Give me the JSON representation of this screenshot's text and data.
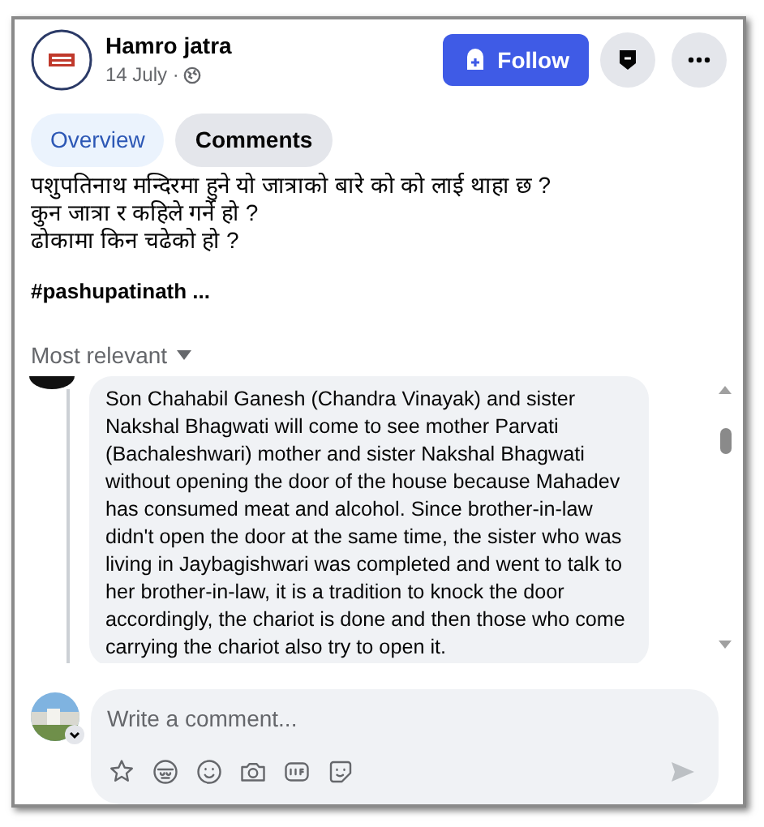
{
  "post": {
    "author": "Hamro jatra",
    "date": "14 July ·",
    "follow_button": "Follow"
  },
  "tabs": [
    {
      "label": "Overview",
      "selected": true
    },
    {
      "label": "Comments",
      "selected": false
    }
  ],
  "post_text": [
    "पशुपतिनाथ मन्दिरमा हुने यो जात्राको बारे को को लाई थाहा छ ?",
    "कुन जात्रा र कहिले गर्ने हो ?",
    "ढोकामा किन चढेको हो ?"
  ],
  "hashtag": "#pashupatinath ...",
  "sort": {
    "label": "Most relevant"
  },
  "comment": {
    "text": "Son Chahabil Ganesh (Chandra Vinayak) and sister Nakshal Bhagwati will come to see mother Parvati (Bachaleshwari) mother and sister Nakshal Bhagwati without opening the door of the house because Mahadev has consumed meat and alcohol. Since brother-in-law didn't open the door at the same time, the sister who was living in Jaybagishwari was completed and went to talk to her brother-in-law, it is a tradition to knock the door accordingly, the chariot is done and then those who come carrying the chariot also try to open it."
  },
  "composer": {
    "placeholder": "Write a comment..."
  }
}
